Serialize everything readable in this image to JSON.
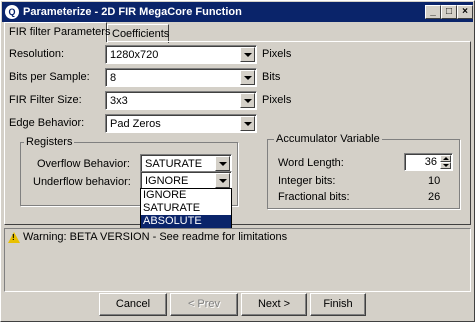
{
  "window": {
    "title": "Parameterize - 2D FIR MegaCore Function",
    "app_icon": "Q",
    "controls": {
      "minimize": "_",
      "maximize": "□",
      "close": "×"
    }
  },
  "tabs": [
    {
      "label": "FIR filter Parameters",
      "active": true
    },
    {
      "label": "Coefficients",
      "active": false
    }
  ],
  "params": {
    "resolution": {
      "label": "Resolution:",
      "value": "1280x720",
      "unit": "Pixels"
    },
    "bits_per_sample": {
      "label": "Bits per Sample:",
      "value": "8",
      "unit": "Bits"
    },
    "filter_size": {
      "label": "FIR Filter Size:",
      "value": "3x3",
      "unit": "Pixels"
    },
    "edge_behavior": {
      "label": "Edge Behavior:",
      "value": "Pad Zeros"
    }
  },
  "registers": {
    "legend": "Registers",
    "overflow": {
      "label": "Overflow Behavior:",
      "value": "SATURATE"
    },
    "underflow": {
      "label": "Underflow behavior:",
      "value": "IGNORE",
      "options": [
        "IGNORE",
        "SATURATE",
        "ABSOLUTE"
      ],
      "highlighted": "ABSOLUTE"
    }
  },
  "accumulator": {
    "legend": "Accumulator Variable",
    "word_length": {
      "label": "Word Length:",
      "value": "36"
    },
    "integer_bits": {
      "label": "Integer bits:",
      "value": "10"
    },
    "fractional_bits": {
      "label": "Fractional bits:",
      "value": "26"
    }
  },
  "message": {
    "icon": "warning-icon",
    "text": "Warning: BETA VERSION - See readme for limitations"
  },
  "buttons": {
    "cancel": "Cancel",
    "prev": "< Prev",
    "next": "Next >",
    "finish": "Finish"
  }
}
